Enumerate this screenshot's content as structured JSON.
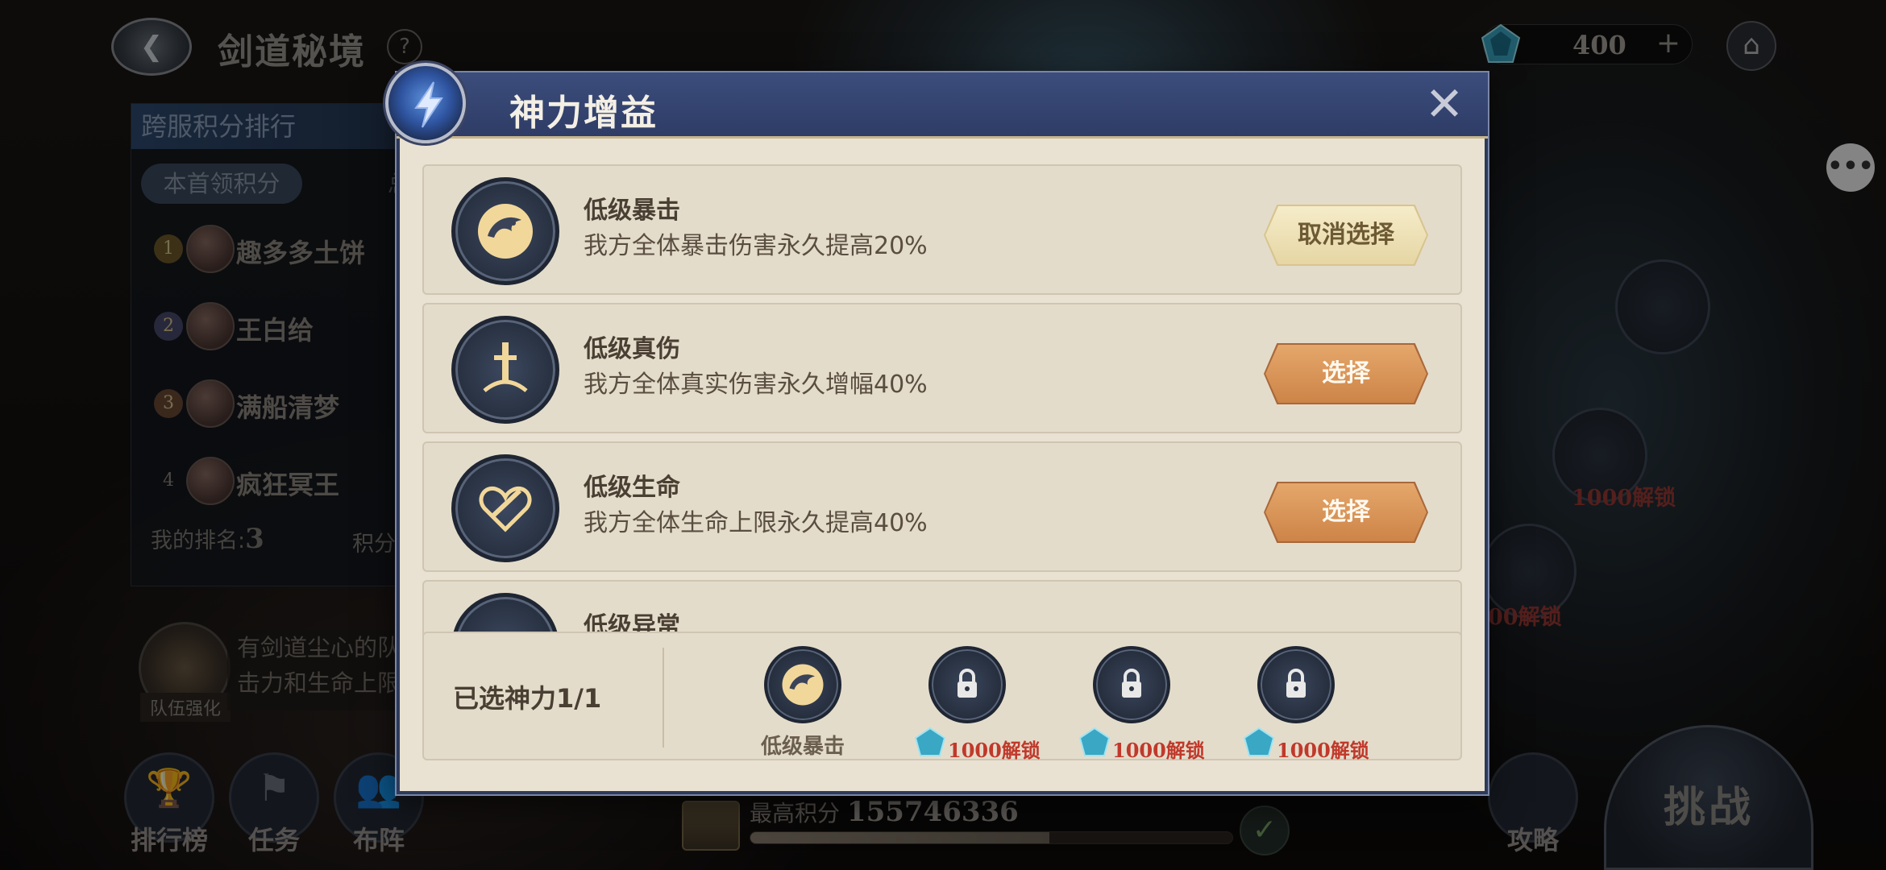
{
  "header": {
    "mode_title": "剑道秘境",
    "help_label": "?",
    "currency_value": "400",
    "currency_plus": "+",
    "home_icon": "home-icon",
    "chat_icon": "chat-icon"
  },
  "ranking": {
    "title": "跨服积分排行",
    "tab_active": "本首领积分",
    "tab_other": "总",
    "entries": [
      {
        "rank": "1",
        "name": "趣多多土饼"
      },
      {
        "rank": "2",
        "name": "王白给"
      },
      {
        "rank": "3",
        "name": "满船清梦"
      },
      {
        "rank": "4",
        "name": "疯狂冥王"
      }
    ],
    "my_rank_label": "我的排名:",
    "my_rank_value": "3",
    "my_score_label": "积分"
  },
  "team_buff": {
    "label": "队伍强化",
    "desc_line1": "有剑道尘心的队",
    "desc_line2": "击力和生命上限"
  },
  "bottom_left": {
    "leaderboard": "排行榜",
    "tasks": "任务",
    "formation": "布阵"
  },
  "bottom_center": {
    "best_score_label": "最高积分",
    "best_score_value": "155746336",
    "progress": 0.62
  },
  "right_side": {
    "lock_cost_1": "1000解锁",
    "lock_cost_2": "00解锁",
    "strategy": "攻略",
    "challenge": "挑战"
  },
  "modal": {
    "title": "神力增益",
    "close_icon": "close-icon",
    "buffs": [
      {
        "name": "低级暴击",
        "desc": "我方全体暴击伤害永久提高20%",
        "button": "取消选择",
        "state": "selected"
      },
      {
        "name": "低级真伤",
        "desc": "我方全体真实伤害永久增幅40%",
        "button": "选择",
        "state": "normal"
      },
      {
        "name": "低级生命",
        "desc": "我方全体生命上限永久提高40%",
        "button": "选择",
        "state": "normal"
      },
      {
        "name": "低级异常",
        "desc": "",
        "button": "",
        "state": "partial"
      }
    ],
    "selected_label": "已选神力1/1",
    "slots": [
      {
        "label": "低级暴击",
        "locked": false
      },
      {
        "cost": "1000解锁",
        "locked": true
      },
      {
        "cost": "1000解锁",
        "locked": true
      },
      {
        "cost": "1000解锁",
        "locked": true
      }
    ]
  },
  "colors": {
    "modal_bg": "#e9e2d3",
    "header_blue": "#2e3c66",
    "button_orange": "#cd8447",
    "button_selected": "#f5ecc9",
    "cost_red": "#c0392b"
  }
}
